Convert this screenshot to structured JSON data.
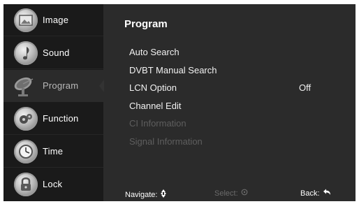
{
  "sidebar": {
    "items": [
      {
        "label": "Image",
        "icon": "image-icon"
      },
      {
        "label": "Sound",
        "icon": "music-note-icon"
      },
      {
        "label": "Program",
        "icon": "satellite-dish-icon",
        "active": true
      },
      {
        "label": "Function",
        "icon": "gears-icon"
      },
      {
        "label": "Time",
        "icon": "clock-icon"
      },
      {
        "label": "Lock",
        "icon": "padlock-icon"
      }
    ]
  },
  "main": {
    "title": "Program",
    "items": [
      {
        "label": "Auto Search",
        "enabled": true
      },
      {
        "label": "DVBT Manual Search",
        "enabled": true
      },
      {
        "label": "LCN Option",
        "value": "Off",
        "enabled": true
      },
      {
        "label": "Channel Edit",
        "enabled": true
      },
      {
        "label": "CI Information",
        "enabled": false
      },
      {
        "label": "Signal Information",
        "enabled": false
      }
    ]
  },
  "footer": {
    "navigate": "Navigate:",
    "select": "Select:",
    "back": "Back:"
  },
  "colors": {
    "background": "#2b2b2b",
    "sidebar": "#1a1a1a",
    "text": "#ffffff",
    "disabled_text": "#5e5e5e"
  }
}
